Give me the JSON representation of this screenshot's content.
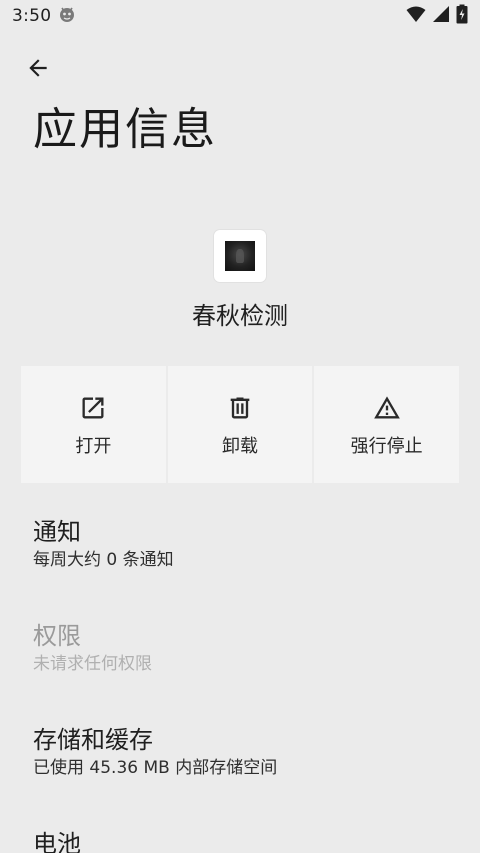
{
  "status_bar": {
    "time": "3:50"
  },
  "header": {
    "title": "应用信息"
  },
  "app": {
    "name": "春秋检测"
  },
  "actions": [
    {
      "label": "打开",
      "icon": "open-external-icon"
    },
    {
      "label": "卸载",
      "icon": "trash-icon"
    },
    {
      "label": "强行停止",
      "icon": "warning-icon"
    }
  ],
  "preferences": {
    "notifications": {
      "title": "通知",
      "summary": "每周大约 0 条通知"
    },
    "permissions": {
      "title": "权限",
      "summary": "未请求任何权限"
    },
    "storage": {
      "title": "存储和缓存",
      "summary": "已使用 45.36 MB 内部存储空间"
    },
    "battery": {
      "title": "电池"
    }
  }
}
